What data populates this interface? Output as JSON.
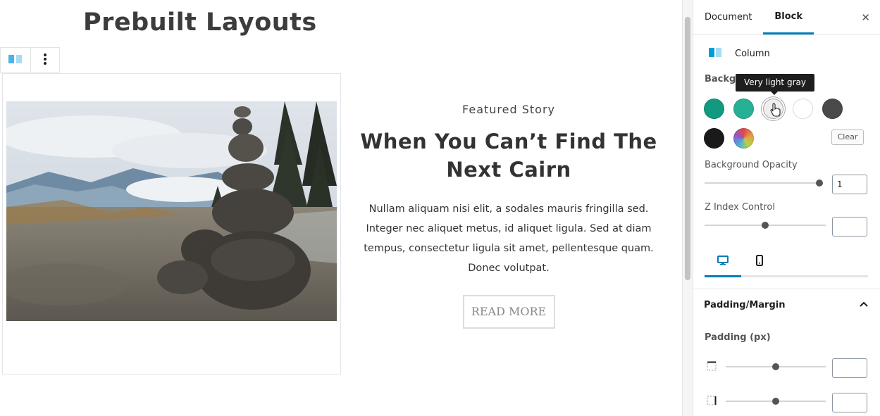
{
  "editor": {
    "page_title": "Prebuilt Layouts",
    "story": {
      "kicker": "Featured Story",
      "headline": "When You Can’t Find The Next Cairn",
      "excerpt": "Nullam aliquam nisi elit, a sodales mauris fringilla sed. Integer nec aliquet metus, id aliquet ligula. Sed at diam tempus, consectetur ligula sit amet, pellentesque quam. Donec volutpat.",
      "button_label": "READ MORE"
    },
    "toolbar": {
      "block_icon": "columns-icon",
      "more_icon": "more-vertical-icon"
    }
  },
  "sidebar": {
    "tabs": [
      {
        "label": "Document",
        "active": false
      },
      {
        "label": "Block",
        "active": true
      }
    ],
    "close_icon": "close-icon",
    "block_name": "Column",
    "background_label": "Backgr",
    "tooltip": "Very light gray",
    "colors": [
      {
        "name": "swatch-1",
        "color": "#129a80"
      },
      {
        "name": "swatch-2",
        "color": "#26b096"
      },
      {
        "name": "Very light gray",
        "color": "#eeeeee",
        "selected": true
      },
      {
        "name": "swatch-4",
        "color": "#ffffff"
      },
      {
        "name": "swatch-5",
        "color": "#4a4a4a"
      },
      {
        "name": "swatch-6",
        "color": "#1a1a1a"
      },
      {
        "name": "custom-color",
        "color": "conic-gradient"
      }
    ],
    "clear_label": "Clear",
    "background_opacity": {
      "label": "Background Opacity",
      "value": "1"
    },
    "z_index": {
      "label": "Z Index Control",
      "value": ""
    },
    "device_tabs": [
      "desktop-icon",
      "mobile-icon"
    ],
    "padding_margin": {
      "title": "Padding/Margin",
      "padding_label": "Padding (px)",
      "top_value": "",
      "right_value": ""
    }
  },
  "accent_color": "#007cba"
}
